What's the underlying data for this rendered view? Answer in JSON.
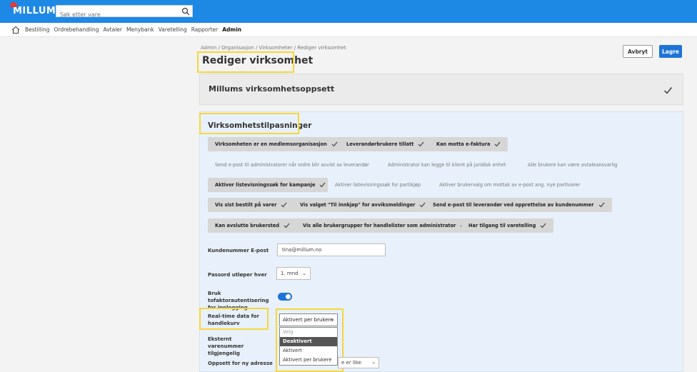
{
  "header": {
    "logo": "MILLUM",
    "search_placeholder": "Søk etter vare"
  },
  "nav": {
    "items": [
      "Bestilling",
      "Ordrebehandling",
      "Avtaler",
      "Menybank",
      "Varetelling",
      "Rapporter",
      "Admin"
    ]
  },
  "page": {
    "breadcrumb": "Admin / Organisasjon / Virksomheter / Rediger virksomhet",
    "title": "Rediger virksomhet",
    "cancel_label": "Avbryt",
    "save_label": "Lagre"
  },
  "setup_section": {
    "title": "Millums virksomhetsoppsett"
  },
  "customizations": {
    "title": "Virksomhetstilpasninger",
    "chips": [
      {
        "label": "Virksomheten er en medlemsorganisasjon",
        "on": true
      },
      {
        "label": "Leverandørbrukere tillatt",
        "on": true
      },
      {
        "label": "Kan motta e-faktura",
        "on": true
      },
      {
        "label": "Send e-post til administratorer når ordre blir avvist av leverandør",
        "on": false
      },
      {
        "label": "Administrator kan legge til klient på juridisk enhet",
        "on": false
      },
      {
        "label": "Alle brukere kan være avtaleansvarlig",
        "on": false
      },
      {
        "label": "Aktiver listevisningssøk for kampanje",
        "on": true
      },
      {
        "label": "Aktiver listevisningssøk for partikjøp",
        "on": false
      },
      {
        "label": "Aktiver brukervalg om mottak av e-post ang. nye partivarer",
        "on": false
      },
      {
        "label": "Vis sist bestilt på varer",
        "on": true
      },
      {
        "label": "Vis valget \"Til innkjøp\" for avviksmeldinger",
        "on": true
      },
      {
        "label": "Send e-post til leverandør ved opprettelse av kundenummer",
        "on": true
      },
      {
        "label": "Kan avslutte brukersted",
        "on": true
      },
      {
        "label": "Vis alle brukergrupper for handlelister som administrator",
        "on": true
      },
      {
        "label": "Har tilgang til varetelling",
        "on": true
      }
    ]
  },
  "form": {
    "email_label": "Kundenummer E-post",
    "email_value": "tina@millum.no",
    "password_label": "Passord utløper hver",
    "password_value": "1. mnd",
    "twofactor_label": "Bruk tofaktorautentisering for innlogging",
    "realtime_label": "Real-time data for handlekurv",
    "realtime_value": "Aktivert per brukere",
    "realtime_options": [
      "Velg",
      "Deaktivert",
      "Aktivert",
      "Aktivert per brukere"
    ],
    "external_label": "Eksternt varenummer tilgjengelig",
    "address_label": "Oppsett for ny adresse",
    "address_value": "e er like"
  },
  "colors": {
    "topbar": "#1e88e5",
    "accent": "#1e73d8",
    "highlight": "#f7d63c"
  }
}
